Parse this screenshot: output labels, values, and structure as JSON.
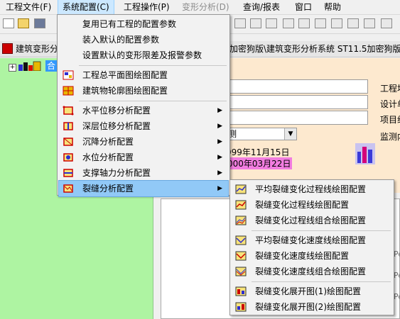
{
  "menubar": [
    {
      "label": "工程文件(F)",
      "state": "normal"
    },
    {
      "label": "系统配置(C)",
      "state": "active"
    },
    {
      "label": "工程操作(P)",
      "state": "normal"
    },
    {
      "label": "变形分析(D)",
      "state": "disabled"
    },
    {
      "label": "查询/报表",
      "state": "normal"
    },
    {
      "label": "窗口",
      "state": "normal"
    },
    {
      "label": "帮助",
      "state": "normal"
    }
  ],
  "window": {
    "title_left": "建筑变形分",
    "title_right": "加密狗版\\建筑变形分析系统 ST11.5加密狗版\\"
  },
  "tree": {
    "root_label": "合"
  },
  "info": {
    "label1": "工程地",
    "label2": "设计单",
    "label3": "项目组",
    "label4": "监测内",
    "combo_value": "测",
    "date_start": "999年11月15日",
    "date_end": "000年03月22日"
  },
  "lower": {
    "pe_label": "Pe"
  },
  "main_menu": {
    "group1": [
      "复用已有工程的配置参数",
      "装入默认的配置参数",
      "设置默认的变形限差及报警参数"
    ],
    "group2": [
      "工程总平面图绘图配置",
      "建筑物轮廓图绘图配置"
    ],
    "group3": [
      "水平位移分析配置",
      "深层位移分析配置",
      "沉降分析配置",
      "水位分析配置",
      "支撑轴力分析配置",
      "裂缝分析配置"
    ]
  },
  "crack_submenu": {
    "group1": [
      "平均裂缝变化过程线绘图配置",
      "裂缝变化过程线绘图配置",
      "裂缝变化过程线组合绘图配置"
    ],
    "group2": [
      "平均裂缝变化速度线绘图配置",
      "裂缝变化速度线绘图配置",
      "裂缝变化速度线组合绘图配置"
    ],
    "group3": [
      "裂缝变化展开图(1)绘图配置",
      "裂缝变化展开图(2)绘图配置"
    ]
  },
  "colors": {
    "tree_bg": "#aef4a2",
    "info_bg": "#fde9cf",
    "highlight": "#91c9f7",
    "date_highlight": "#f27de0"
  }
}
